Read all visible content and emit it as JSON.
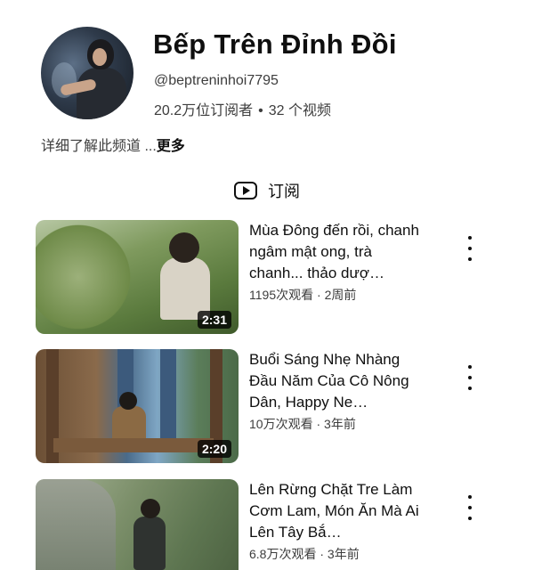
{
  "channel": {
    "name": "Bếp Trên Đỉnh Đồi",
    "handle": "@beptreninhoi7795",
    "subscribers": "20.2万位订阅者",
    "separator": "•",
    "video_count": "32 个视频",
    "about_text": "详细了解此频道 ...",
    "about_more": "更多"
  },
  "subscribe": {
    "label": "订阅",
    "icon": "play-box-icon"
  },
  "videos": [
    {
      "title": "Mùa Đông đến rồi, chanh ngâm mật ong, trà chanh... thảo dượ…",
      "views": "1195次观看",
      "age": "2周前",
      "duration": "2:31"
    },
    {
      "title": "Buổi Sáng Nhẹ Nhàng Đầu Năm Của Cô Nông Dân, Happy Ne…",
      "views": "10万次观看",
      "age": "3年前",
      "duration": "2:20"
    },
    {
      "title": "Lên Rừng Chặt Tre Làm Cơm Lam, Món Ăn Mà Ai Lên Tây Bắ…",
      "views": "6.8万次观看",
      "age": "3年前",
      "duration": ""
    }
  ],
  "meta_separator": " · "
}
